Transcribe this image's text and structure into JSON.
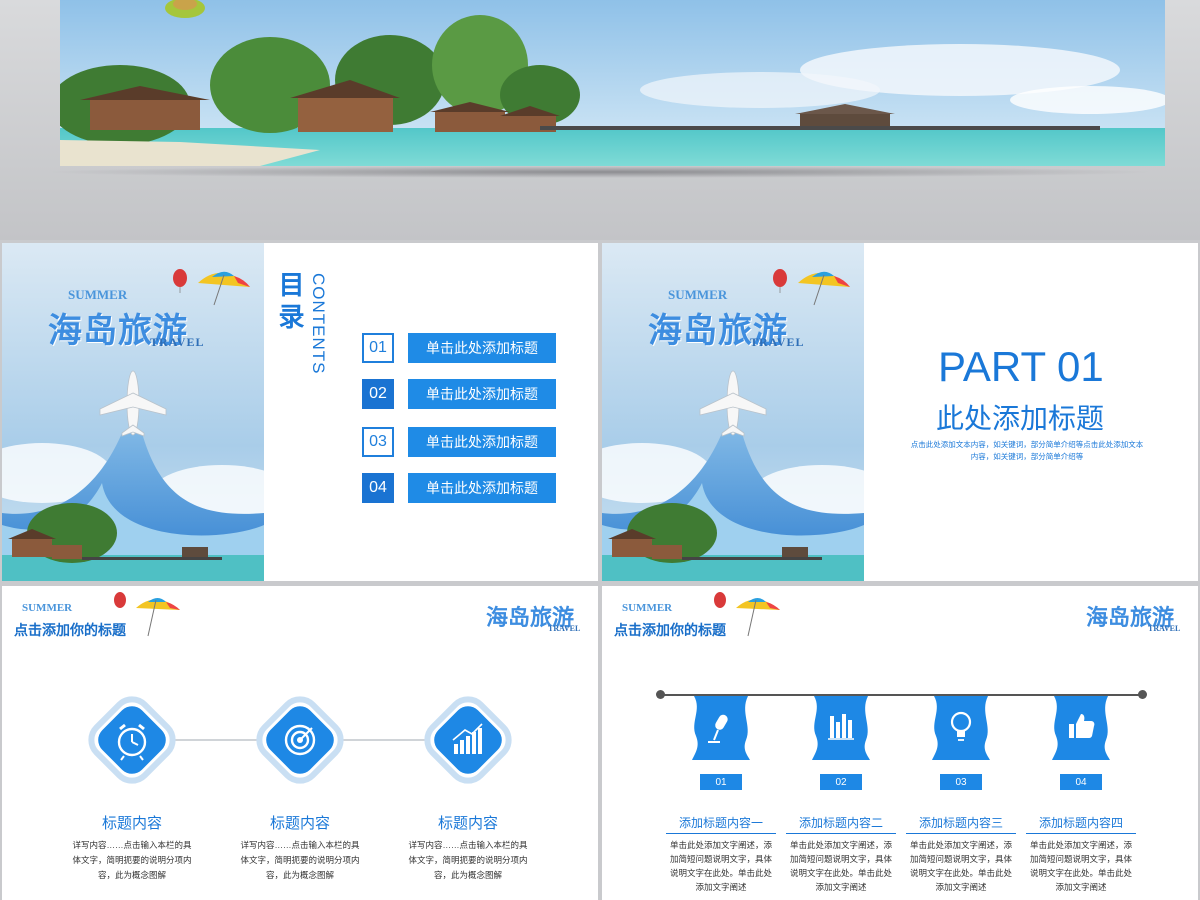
{
  "colors": {
    "accent": "#1a78d8",
    "accent_light": "#1f8be6",
    "background": "#c9cacd"
  },
  "brand": {
    "summer": "SUMMER",
    "title_cn": "海岛旅游",
    "travel": "TRAVEL"
  },
  "contents_slide": {
    "title_cn": "目录",
    "title_en": "CONTENTS",
    "items": [
      {
        "num": "01",
        "label": "单击此处添加标题"
      },
      {
        "num": "02",
        "label": "单击此处添加标题"
      },
      {
        "num": "03",
        "label": "单击此处添加标题"
      },
      {
        "num": "04",
        "label": "单击此处添加标题"
      }
    ]
  },
  "part_slide": {
    "title": "PART 01",
    "subtitle": "此处添加标题",
    "desc_line1": "点击此处添加文本内容，如关键词，部分简单介绍等点击此处添加文本",
    "desc_line2": "内容，如关键词，部分简单介绍等"
  },
  "features_slide": {
    "summer": "SUMMER",
    "header": "点击添加你的标题",
    "logo": "海岛旅游",
    "travel": "TRAVEL",
    "items": [
      {
        "icon": "alarm-clock-icon",
        "title": "标题内容",
        "desc": [
          "详写内容……点击输入本栏的具",
          "体文字，简明扼要的说明分项内",
          "容，此为概念图解"
        ]
      },
      {
        "icon": "target-icon",
        "title": "标题内容",
        "desc": [
          "详写内容……点击输入本栏的具",
          "体文字，简明扼要的说明分项内",
          "容，此为概念图解"
        ]
      },
      {
        "icon": "bar-chart-icon",
        "title": "标题内容",
        "desc": [
          "详写内容……点击输入本栏的具",
          "体文字，简明扼要的说明分项内",
          "容，此为概念图解"
        ]
      }
    ]
  },
  "timeline_slide": {
    "summer": "SUMMER",
    "header": "点击添加你的标题",
    "logo": "海岛旅游",
    "travel": "TRAVEL",
    "items": [
      {
        "icon": "microphone-icon",
        "num": "01",
        "title": "添加标题内容一",
        "desc": [
          "单击此处添加文字阐述，添",
          "加简短问题说明文字，具体",
          "说明文字在此处。单击此处",
          "添加文字阐述"
        ]
      },
      {
        "icon": "bar-chart-icon",
        "num": "02",
        "title": "添加标题内容二",
        "desc": [
          "单击此处添加文字阐述，添",
          "加简短问题说明文字，具体",
          "说明文字在此处。单击此处",
          "添加文字阐述"
        ]
      },
      {
        "icon": "lightbulb-icon",
        "num": "03",
        "title": "添加标题内容三",
        "desc": [
          "单击此处添加文字阐述，添",
          "加简短问题说明文字，具体",
          "说明文字在此处。单击此处",
          "添加文字阐述"
        ]
      },
      {
        "icon": "thumbs-up-icon",
        "num": "04",
        "title": "添加标题内容四",
        "desc": [
          "单击此处添加文字阐述，添",
          "加简短问题说明文字，具体",
          "说明文字在此处。单击此处",
          "添加文字阐述"
        ]
      }
    ]
  }
}
